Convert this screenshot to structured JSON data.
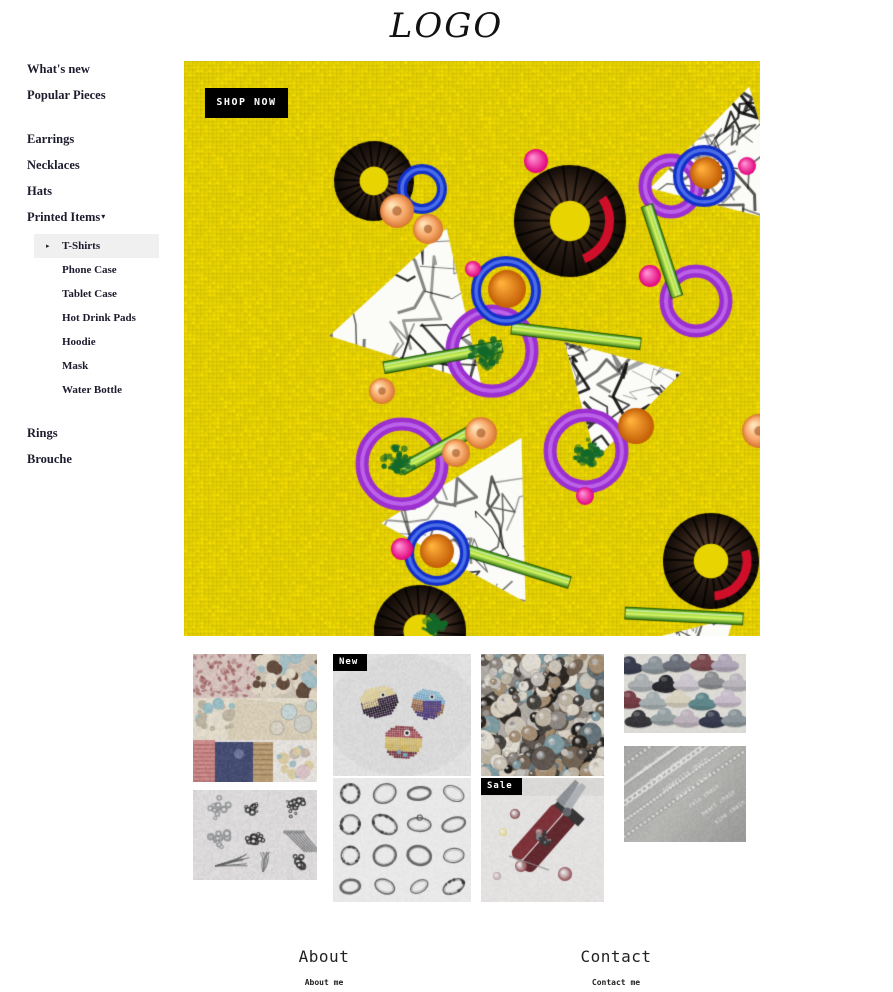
{
  "header": {
    "logo": "LOGO"
  },
  "sidebar": {
    "top_items": [
      {
        "label": "What's new"
      },
      {
        "label": "Popular Pieces"
      }
    ],
    "category_items": [
      {
        "label": "Earrings",
        "has_caret": false
      },
      {
        "label": "Necklaces",
        "has_caret": false
      },
      {
        "label": "Hats",
        "has_caret": false
      },
      {
        "label": "Printed Items",
        "has_caret": true,
        "caret": "▾"
      }
    ],
    "submenu": [
      {
        "label": "T-Shirts",
        "active": true,
        "bullet": "▸"
      },
      {
        "label": "Phone Case",
        "active": false
      },
      {
        "label": "Tablet Case",
        "active": false
      },
      {
        "label": "Hot Drink Pads",
        "active": false
      },
      {
        "label": "Hoodie",
        "active": false
      },
      {
        "label": "Mask",
        "active": false
      },
      {
        "label": "Water Bottle",
        "active": false
      }
    ],
    "bottom_items": [
      {
        "label": "Rings"
      },
      {
        "label": "Brouche"
      }
    ],
    "highlight_color": "#f0f0f0",
    "text_color": "#1c1c2e"
  },
  "hero": {
    "cta_label": "SHOP NOW",
    "alt": "jewelry-pieces-on-yellow-burlap",
    "background_color": "#e4cf08",
    "cta_background": "#000000",
    "cta_text_color": "#ffffff"
  },
  "grid": {
    "columns": [
      {
        "name": "column-1",
        "tiles": [
          {
            "name": "tile-pastel-collage",
            "alt": "pastel-beads-collage",
            "badge": null
          },
          {
            "name": "tile-findings",
            "alt": "silver-findings-on-white",
            "badge": null
          }
        ]
      },
      {
        "name": "column-2",
        "tiles": [
          {
            "name": "tile-bird-brooches",
            "alt": "beaded-bird-brooches",
            "badge": "New"
          },
          {
            "name": "tile-rings-grid",
            "alt": "silver-rings-grid",
            "badge": null
          }
        ]
      },
      {
        "name": "column-3",
        "tiles": [
          {
            "name": "tile-bead-mix",
            "alt": "mixed-beads-closeup",
            "badge": null
          },
          {
            "name": "tile-pliers",
            "alt": "pliers-and-beads-workbench",
            "badge": "Sale"
          }
        ]
      },
      {
        "name": "column-4",
        "tiles": [
          {
            "name": "tile-hats",
            "alt": "colored-sun-hats-rows",
            "badge": null
          },
          {
            "name": "tile-chains",
            "alt": "silver-chain-types",
            "badge": null
          }
        ]
      }
    ]
  },
  "footer": {
    "columns": [
      {
        "heading": "About",
        "link": "About me"
      },
      {
        "heading": "Contact",
        "link": "Contact me"
      }
    ]
  }
}
